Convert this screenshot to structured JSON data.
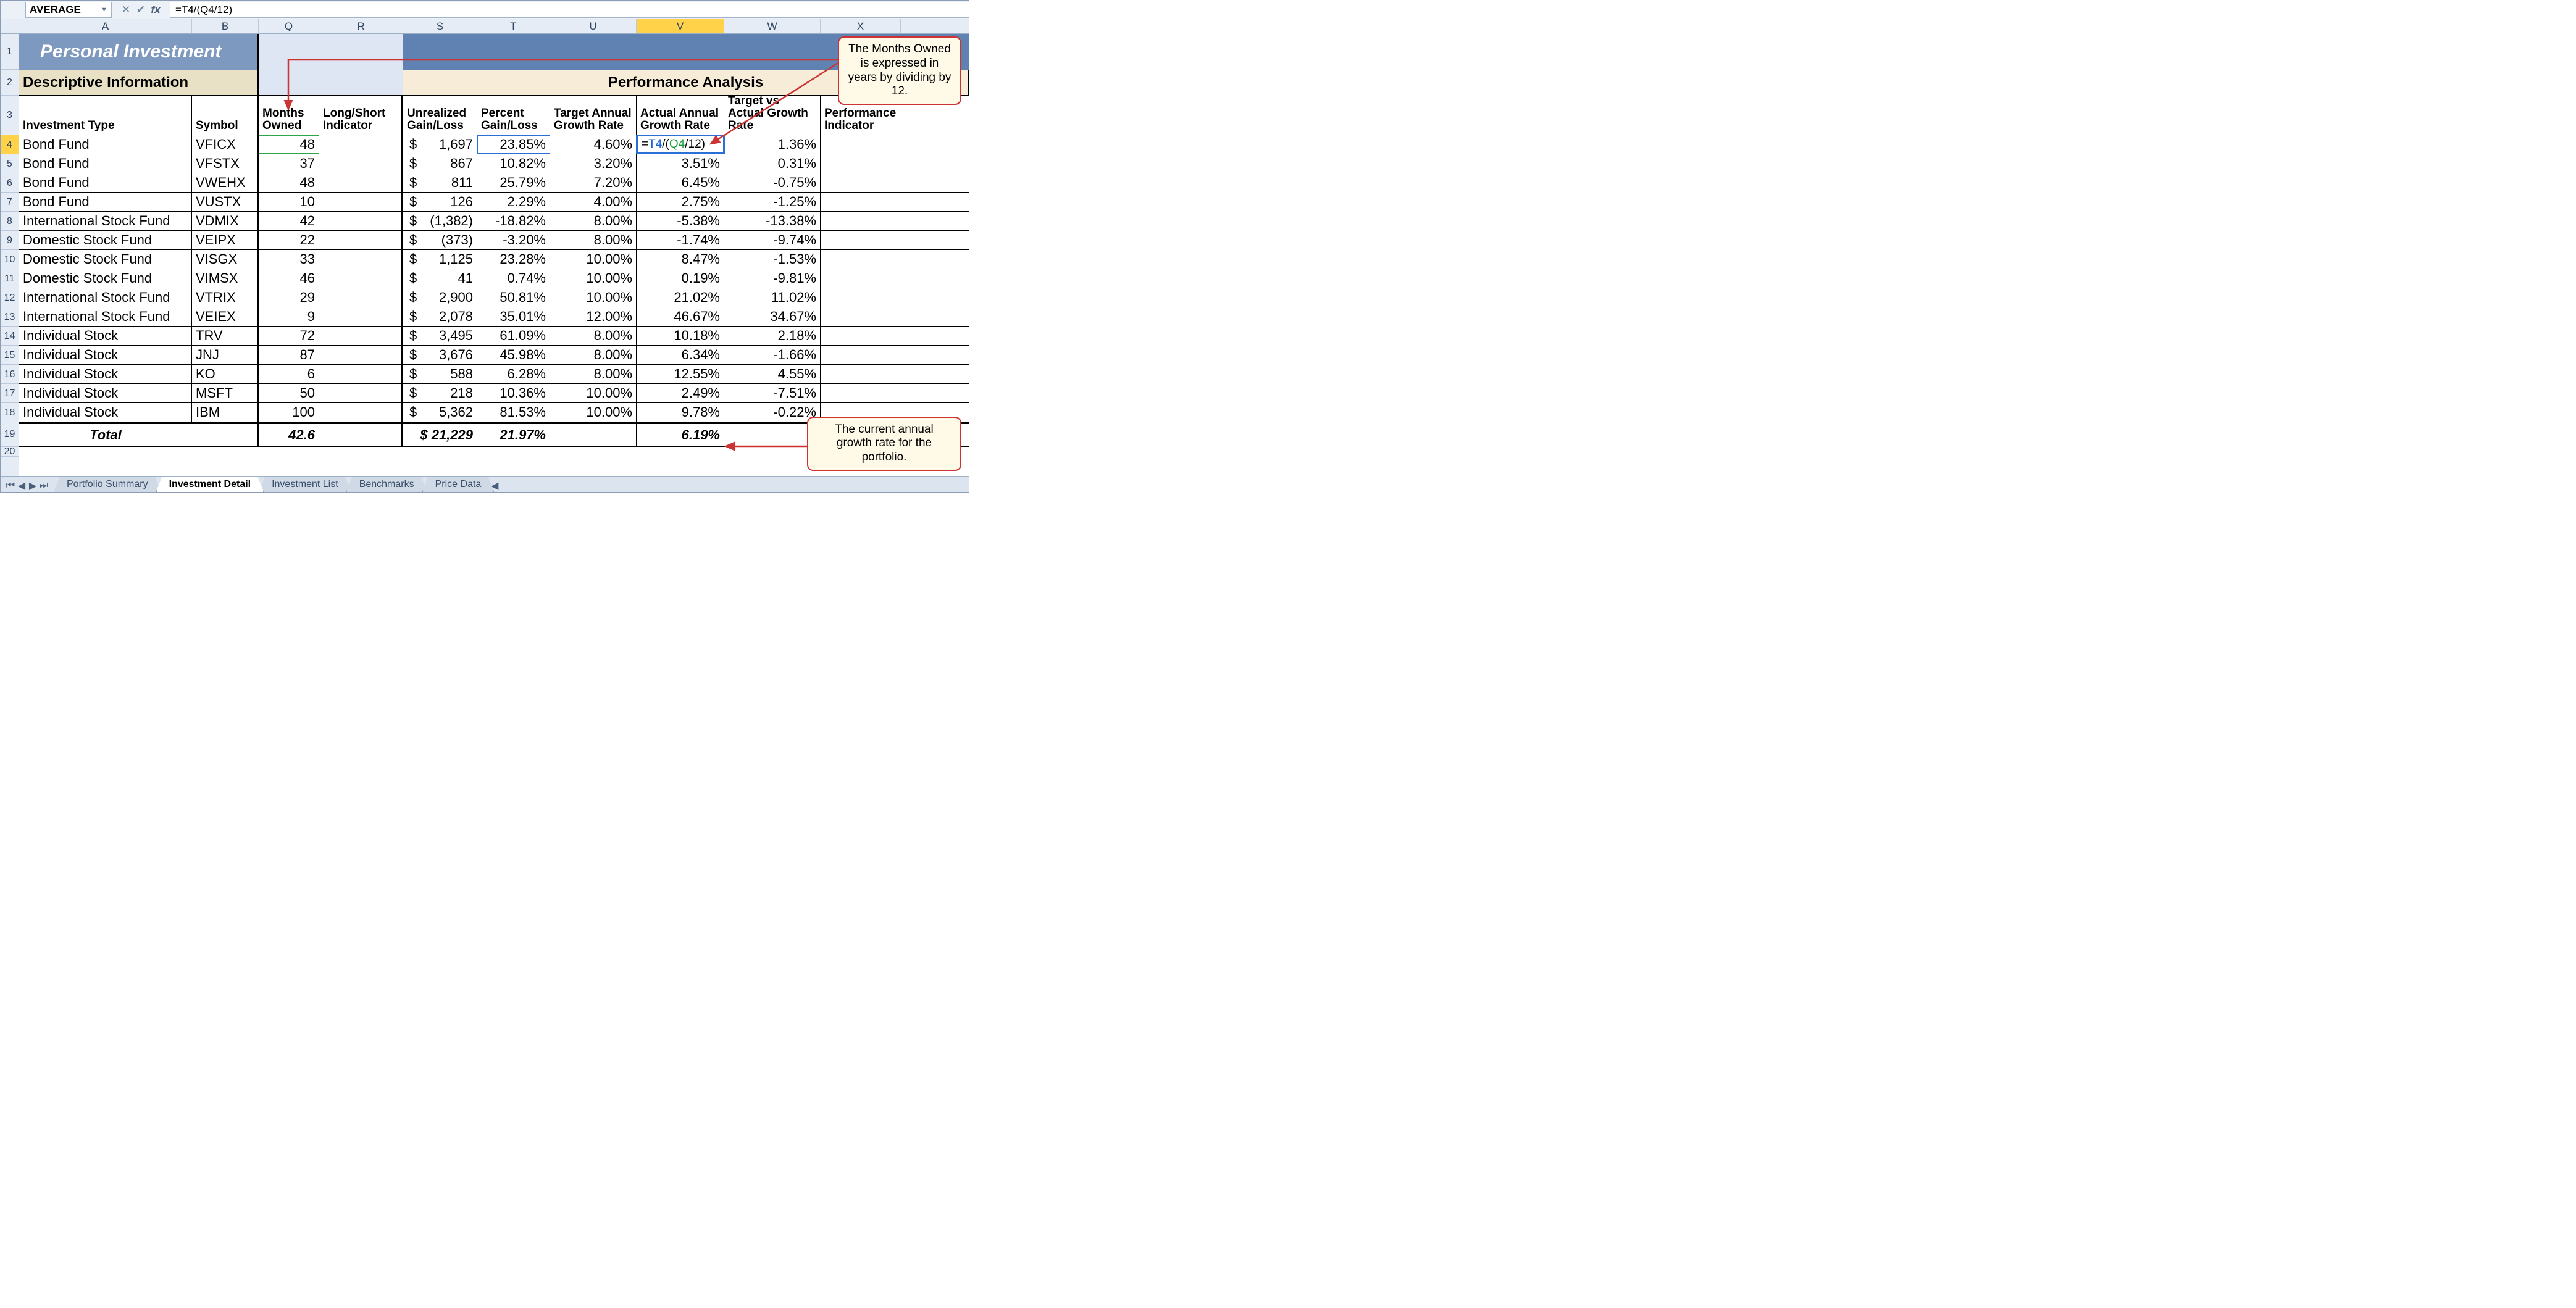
{
  "formula_bar": {
    "name_box": "AVERAGE",
    "formula": "=T4/(Q4/12)"
  },
  "columns": [
    "A",
    "B",
    "Q",
    "R",
    "S",
    "T",
    "U",
    "V",
    "W",
    "X"
  ],
  "active_col": "V",
  "active_row": "4",
  "titles": {
    "main": "Personal Investment",
    "desc": "Descriptive Information",
    "perf": "Performance Analysis"
  },
  "headers": {
    "A": "Investment Type",
    "B": "Symbol",
    "Q": "Months Owned",
    "R": "Long/Short Indicator",
    "S": "Unrealized Gain/Loss",
    "T": "Percent Gain/Loss",
    "U": "Target Annual Growth Rate",
    "V": "Actual Annual Growth Rate",
    "W": "Target vs Actual Growth Rate",
    "X": "Performance Indicator"
  },
  "edit_formula_display": {
    "prefix": "=",
    "r1": "T4",
    "mid": "/(",
    "r2": "Q4",
    "suffix": "/12)"
  },
  "rows": [
    {
      "n": "4",
      "A": "Bond Fund",
      "B": "VFICX",
      "Q": "48",
      "S": "1,697",
      "T": "23.85%",
      "U": "4.60%",
      "V": "=T4/(Q4/12)",
      "W": "1.36%"
    },
    {
      "n": "5",
      "A": "Bond Fund",
      "B": "VFSTX",
      "Q": "37",
      "S": "867",
      "T": "10.82%",
      "U": "3.20%",
      "V": "3.51%",
      "W": "0.31%"
    },
    {
      "n": "6",
      "A": "Bond Fund",
      "B": "VWEHX",
      "Q": "48",
      "S": "811",
      "T": "25.79%",
      "U": "7.20%",
      "V": "6.45%",
      "W": "-0.75%"
    },
    {
      "n": "7",
      "A": "Bond Fund",
      "B": "VUSTX",
      "Q": "10",
      "S": "126",
      "T": "2.29%",
      "U": "4.00%",
      "V": "2.75%",
      "W": "-1.25%"
    },
    {
      "n": "8",
      "A": "International Stock Fund",
      "B": "VDMIX",
      "Q": "42",
      "S": "(1,382)",
      "T": "-18.82%",
      "U": "8.00%",
      "V": "-5.38%",
      "W": "-13.38%"
    },
    {
      "n": "9",
      "A": "Domestic Stock Fund",
      "B": "VEIPX",
      "Q": "22",
      "S": "(373)",
      "T": "-3.20%",
      "U": "8.00%",
      "V": "-1.74%",
      "W": "-9.74%"
    },
    {
      "n": "10",
      "A": "Domestic Stock Fund",
      "B": "VISGX",
      "Q": "33",
      "S": "1,125",
      "T": "23.28%",
      "U": "10.00%",
      "V": "8.47%",
      "W": "-1.53%"
    },
    {
      "n": "11",
      "A": "Domestic Stock Fund",
      "B": "VIMSX",
      "Q": "46",
      "S": "41",
      "T": "0.74%",
      "U": "10.00%",
      "V": "0.19%",
      "W": "-9.81%"
    },
    {
      "n": "12",
      "A": "International Stock Fund",
      "B": "VTRIX",
      "Q": "29",
      "S": "2,900",
      "T": "50.81%",
      "U": "10.00%",
      "V": "21.02%",
      "W": "11.02%"
    },
    {
      "n": "13",
      "A": "International Stock Fund",
      "B": "VEIEX",
      "Q": "9",
      "S": "2,078",
      "T": "35.01%",
      "U": "12.00%",
      "V": "46.67%",
      "W": "34.67%"
    },
    {
      "n": "14",
      "A": "Individual Stock",
      "B": "TRV",
      "Q": "72",
      "S": "3,495",
      "T": "61.09%",
      "U": "8.00%",
      "V": "10.18%",
      "W": "2.18%"
    },
    {
      "n": "15",
      "A": "Individual Stock",
      "B": "JNJ",
      "Q": "87",
      "S": "3,676",
      "T": "45.98%",
      "U": "8.00%",
      "V": "6.34%",
      "W": "-1.66%"
    },
    {
      "n": "16",
      "A": "Individual Stock",
      "B": "KO",
      "Q": "6",
      "S": "588",
      "T": "6.28%",
      "U": "8.00%",
      "V": "12.55%",
      "W": "4.55%"
    },
    {
      "n": "17",
      "A": "Individual Stock",
      "B": "MSFT",
      "Q": "50",
      "S": "218",
      "T": "10.36%",
      "U": "10.00%",
      "V": "2.49%",
      "W": "-7.51%"
    },
    {
      "n": "18",
      "A": "Individual Stock",
      "B": "IBM",
      "Q": "100",
      "S": "5,362",
      "T": "81.53%",
      "U": "10.00%",
      "V": "9.78%",
      "W": "-0.22%"
    }
  ],
  "total": {
    "label": "Total",
    "Q": "42.6",
    "S": "$ 21,229",
    "T": "21.97%",
    "V": "6.19%"
  },
  "tabs": [
    "Portfolio Summary",
    "Investment Detail",
    "Investment List",
    "Benchmarks",
    "Price Data"
  ],
  "active_tab": "Investment Detail",
  "callouts": {
    "c1": "The Months Owned is expressed in years by dividing by 12.",
    "c2": "The current annual growth rate for the portfolio."
  },
  "row_numbers": [
    "1",
    "2",
    "3",
    "4",
    "5",
    "6",
    "7",
    "8",
    "9",
    "10",
    "11",
    "12",
    "13",
    "14",
    "15",
    "16",
    "17",
    "18",
    "19",
    "20"
  ],
  "dollar": "$"
}
